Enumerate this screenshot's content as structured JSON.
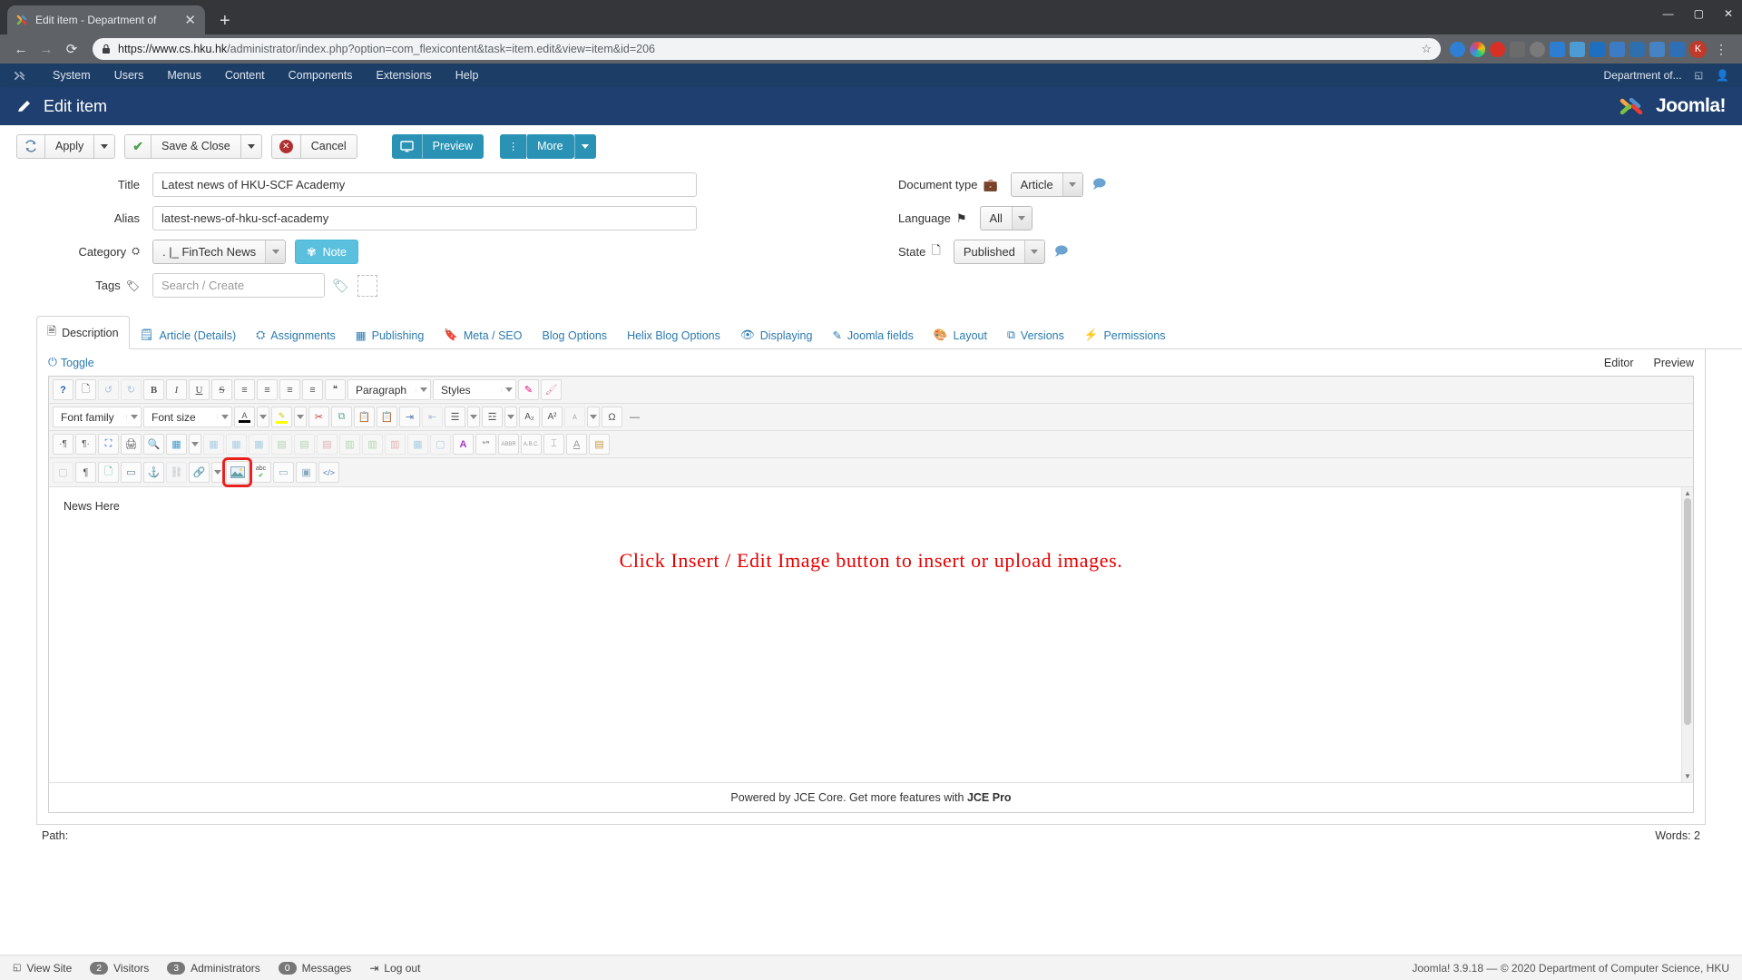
{
  "browser": {
    "tab": {
      "title": "Edit item - Department of",
      "favicon": "joomla-favicon",
      "close": "✕"
    },
    "new_tab": "+",
    "window_controls": {
      "minimize": "—",
      "maximize": "▢",
      "close": "✕"
    },
    "nav": {
      "back": "←",
      "forward": "→",
      "reload": "⟳"
    },
    "omnibox": {
      "lock": "🔒",
      "url_host": "https://www.cs.hku.hk",
      "url_path": "/administrator/index.php?option=com_flexicontent&task=item.edit&view=item&id=206",
      "star": "☆"
    },
    "extensions": [
      "opera-icon",
      "color-wheel-icon",
      "adblock-icon",
      "mic-icon",
      "clock-icon",
      "s-icon",
      "grid-icon",
      "blue-icon",
      "gear-icon",
      "check-icon",
      "folder-icon",
      "key-icon"
    ],
    "profile_initial": "K",
    "menu": "⋮"
  },
  "adminbar": {
    "logo": "joomla-logo-icon",
    "items": [
      "System",
      "Users",
      "Menus",
      "Content",
      "Components",
      "Extensions",
      "Help"
    ],
    "site_name": "Department of...",
    "external_icon": "external-link-icon",
    "user_icon": "user-icon"
  },
  "pagehead": {
    "icon": "pencil-icon",
    "title": "Edit item",
    "brand": "Joomla!",
    "brand_mark": "joomla-mark-icon"
  },
  "toolbar": {
    "apply": "Apply",
    "apply_icon": "refresh-icon",
    "save_close": "Save & Close",
    "save_icon": "check-icon",
    "cancel": "Cancel",
    "cancel_icon": "cancel-icon",
    "preview": "Preview",
    "preview_icon": "monitor-icon",
    "more": "More",
    "more_icon": "vertical-dots-icon",
    "accent_color": "#2a93b5"
  },
  "form": {
    "title_label": "Title",
    "title_value": "Latest news of HKU-SCF Academy",
    "alias_label": "Alias",
    "alias_value": "latest-news-of-hku-scf-academy",
    "category_label": "Category",
    "category_icon": "sitemap-icon",
    "category_value": ". |_ FinTech News",
    "note_label": "Note",
    "note_icon": "gear-icon",
    "tags_label": "Tags",
    "tags_icon": "tag-icon",
    "tags_placeholder": "Search / Create",
    "tags_add_icon": "add-tag-icon",
    "doctype_label": "Document type",
    "doctype_icon": "briefcase-icon",
    "doctype_value": "Article",
    "language_label": "Language",
    "language_icon": "flag-icon",
    "language_value": "All",
    "state_label": "State",
    "state_icon": "page-icon",
    "state_value": "Published",
    "tooltip_icon": "comment-icon"
  },
  "tabs": [
    {
      "label": "Description",
      "icon": "document-icon",
      "active": true
    },
    {
      "label": "Article (Details)",
      "icon": "clipboard-icon",
      "active": false
    },
    {
      "label": "Assignments",
      "icon": "sitemap-icon",
      "active": false
    },
    {
      "label": "Publishing",
      "icon": "calendar-icon",
      "active": false
    },
    {
      "label": "Meta / SEO",
      "icon": "bookmark-icon",
      "active": false
    },
    {
      "label": "Blog Options",
      "icon": "",
      "active": false
    },
    {
      "label": "Helix Blog Options",
      "icon": "",
      "active": false
    },
    {
      "label": "Displaying",
      "icon": "eye-icon",
      "active": false
    },
    {
      "label": "Joomla fields",
      "icon": "pencil-icon",
      "active": false
    },
    {
      "label": "Layout",
      "icon": "palette-icon",
      "active": false
    },
    {
      "label": "Versions",
      "icon": "copy-icon",
      "active": false
    },
    {
      "label": "Permissions",
      "icon": "plug-icon",
      "active": false
    }
  ],
  "editor": {
    "toggle": "Toggle",
    "toggle_icon": "power-icon",
    "mode_editor": "Editor",
    "mode_preview": "Preview",
    "row1": [
      {
        "n": "help-icon",
        "g": "?"
      },
      {
        "n": "new-document-icon",
        "g": "▢"
      },
      {
        "n": "undo-icon",
        "g": "↺",
        "dis": true
      },
      {
        "n": "redo-icon",
        "g": "↻",
        "dis": true
      },
      {
        "n": "bold-icon",
        "g": "B"
      },
      {
        "n": "italic-icon",
        "g": "I"
      },
      {
        "n": "underline-icon",
        "g": "U"
      },
      {
        "n": "strikethrough-icon",
        "g": "S"
      },
      {
        "n": "align-justify-icon",
        "g": "≡"
      },
      {
        "n": "align-center-icon",
        "g": "≡"
      },
      {
        "n": "align-left-icon",
        "g": "≡"
      },
      {
        "n": "align-right-icon",
        "g": "≡"
      },
      {
        "n": "blockquote-icon",
        "g": "❝"
      }
    ],
    "paragraph_select": "Paragraph",
    "styles_select": "Styles",
    "row1_end": [
      {
        "n": "eraser-icon",
        "g": "⌫"
      },
      {
        "n": "format-painter-icon",
        "g": "🖌"
      }
    ],
    "fontfamily_select": "Font family",
    "fontsize_select": "Font size",
    "row2": [
      {
        "n": "text-color-icon",
        "g": "A"
      },
      {
        "n": "highlight-color-icon",
        "g": "✎"
      },
      {
        "n": "cut-icon",
        "g": "✂"
      },
      {
        "n": "copy-icon",
        "g": "⧉"
      },
      {
        "n": "paste-icon",
        "g": "📋"
      },
      {
        "n": "paste-text-icon",
        "g": "📋"
      },
      {
        "n": "indent-icon",
        "g": "⇥"
      },
      {
        "n": "outdent-icon",
        "g": "⇤",
        "dis": true
      },
      {
        "n": "ordered-list-icon",
        "g": "☰"
      },
      {
        "n": "unordered-list-icon",
        "g": "☲"
      },
      {
        "n": "subscript-icon",
        "g": "A₂"
      },
      {
        "n": "superscript-icon",
        "g": "A²"
      },
      {
        "n": "clear-formatting-icon",
        "g": "ᴀ",
        "dis": true
      },
      {
        "n": "special-character-icon",
        "g": "Ω"
      },
      {
        "n": "horizontal-rule-icon",
        "g": "—"
      }
    ],
    "row3": [
      {
        "n": "ltr-icon",
        "g": "¶"
      },
      {
        "n": "rtl-icon",
        "g": "¶"
      },
      {
        "n": "fullscreen-icon",
        "g": "⛶"
      },
      {
        "n": "print-icon",
        "g": "🖨"
      },
      {
        "n": "search-replace-icon",
        "g": "🔍"
      },
      {
        "n": "insert-table-icon",
        "g": "▦"
      },
      {
        "n": "delete-table-icon",
        "g": "▦",
        "dis": true
      },
      {
        "n": "table-row-properties-icon",
        "g": "▦",
        "dis": true
      },
      {
        "n": "table-cell-properties-icon",
        "g": "▦",
        "dis": true
      },
      {
        "n": "insert-row-before-icon",
        "g": "▤",
        "dis": true
      },
      {
        "n": "insert-row-after-icon",
        "g": "▤",
        "dis": true
      },
      {
        "n": "delete-row-icon",
        "g": "▤",
        "dis": true
      },
      {
        "n": "insert-column-before-icon",
        "g": "▥",
        "dis": true
      },
      {
        "n": "insert-column-after-icon",
        "g": "▥",
        "dis": true
      },
      {
        "n": "delete-column-icon",
        "g": "▥",
        "dis": true
      },
      {
        "n": "split-cells-icon",
        "g": "▦",
        "dis": true
      },
      {
        "n": "merge-cells-icon",
        "g": "▢",
        "dis": true
      },
      {
        "n": "font-select-icon",
        "g": "A"
      },
      {
        "n": "quote-icon",
        "g": "❞"
      },
      {
        "n": "abbreviation-icon",
        "g": "ABBR"
      },
      {
        "n": "acronym-icon",
        "g": "A.B.C."
      },
      {
        "n": "cite-icon",
        "g": "⌶"
      },
      {
        "n": "del-icon",
        "g": "A"
      },
      {
        "n": "attributes-icon",
        "g": "▤"
      }
    ],
    "row4": [
      {
        "n": "visual-blocks-icon",
        "g": "▢",
        "dis": true
      },
      {
        "n": "visual-chars-icon",
        "g": "¶"
      },
      {
        "n": "page-break-icon",
        "g": "▤"
      },
      {
        "n": "insert-readmore-icon",
        "g": "▭"
      },
      {
        "n": "anchor-icon",
        "g": "⚓"
      },
      {
        "n": "unlink-icon",
        "g": "⛓",
        "dis": true
      },
      {
        "n": "link-icon",
        "g": "🔗"
      }
    ],
    "image_button": {
      "n": "insert-edit-image-icon",
      "highlighted": true,
      "highlight_color": "#e8201e"
    },
    "row4_end": [
      {
        "n": "spellcheck-icon",
        "g": "abc"
      },
      {
        "n": "horizontal-rule2-icon",
        "g": "▭"
      },
      {
        "n": "template-icon",
        "g": "▣"
      },
      {
        "n": "source-code-icon",
        "g": "<>"
      }
    ],
    "content_text": "News Here",
    "content_highlight": "Click Insert / Edit Image button to insert or upload images.",
    "highlight_color": "#e60000",
    "footer_prefix": "Powered by JCE Core. Get more features with ",
    "footer_link": "JCE Pro",
    "below_left": "Path:",
    "below_right": "Words: 2"
  },
  "statusbar": {
    "view_site": "View Site",
    "view_site_icon": "external-link-icon",
    "visitors_count": "2",
    "visitors": "Visitors",
    "admins_count": "3",
    "admins": "Administrators",
    "messages_count": "0",
    "messages": "Messages",
    "logout": "Log out",
    "logout_icon": "logout-icon",
    "copyright": "Joomla! 3.9.18  —  © 2020 Department of Computer Science, HKU"
  }
}
